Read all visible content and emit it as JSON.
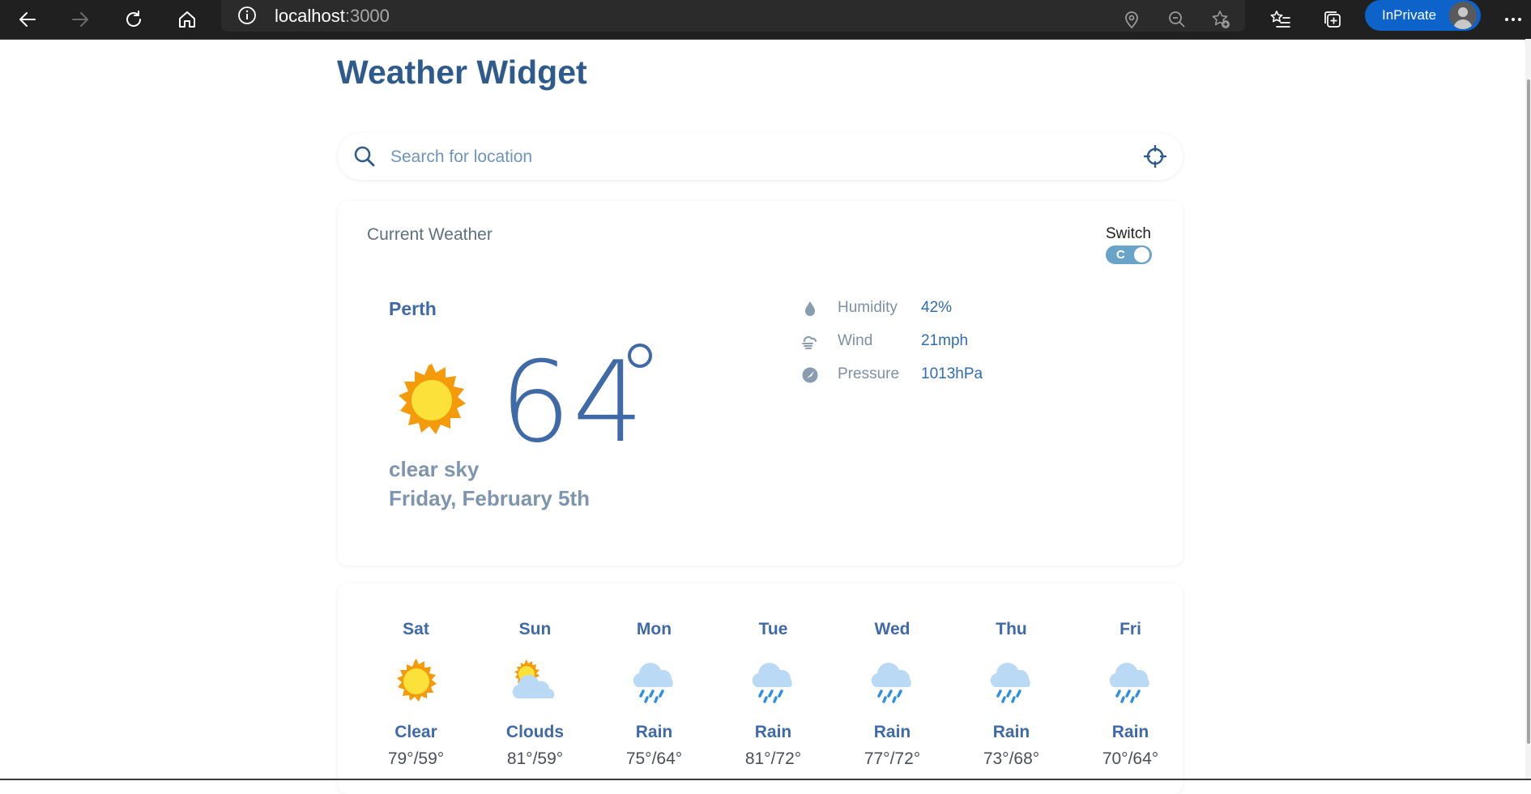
{
  "browser": {
    "url_host": "localhost",
    "url_port": ":3000",
    "inprivate_label": "InPrivate"
  },
  "app": {
    "title": "Weather Widget",
    "search_placeholder": "Search for location",
    "accent": "#3f6aa7"
  },
  "current": {
    "section_label": "Current Weather",
    "switch_label": "Switch",
    "unit_letter": "C",
    "city": "Perth",
    "temperature": "64",
    "description": "clear sky",
    "date": "Friday, February 5th",
    "icon": "sun-icon",
    "stats": [
      {
        "label": "Humidity",
        "value": "42%",
        "icon": "droplet-icon"
      },
      {
        "label": "Wind",
        "value": "21mph",
        "icon": "wind-icon"
      },
      {
        "label": "Pressure",
        "value": "1013hPa",
        "icon": "gauge-icon"
      }
    ]
  },
  "forecast": [
    {
      "day": "Sat",
      "condition": "Clear",
      "temps": "79°/59°",
      "icon": "sun-icon"
    },
    {
      "day": "Sun",
      "condition": "Clouds",
      "temps": "81°/59°",
      "icon": "partly-cloudy-icon"
    },
    {
      "day": "Mon",
      "condition": "Rain",
      "temps": "75°/64°",
      "icon": "rain-icon"
    },
    {
      "day": "Tue",
      "condition": "Rain",
      "temps": "81°/72°",
      "icon": "rain-icon"
    },
    {
      "day": "Wed",
      "condition": "Rain",
      "temps": "77°/72°",
      "icon": "rain-icon"
    },
    {
      "day": "Thu",
      "condition": "Rain",
      "temps": "73°/68°",
      "icon": "rain-icon"
    },
    {
      "day": "Fri",
      "condition": "Rain",
      "temps": "70°/64°",
      "icon": "rain-icon"
    }
  ]
}
